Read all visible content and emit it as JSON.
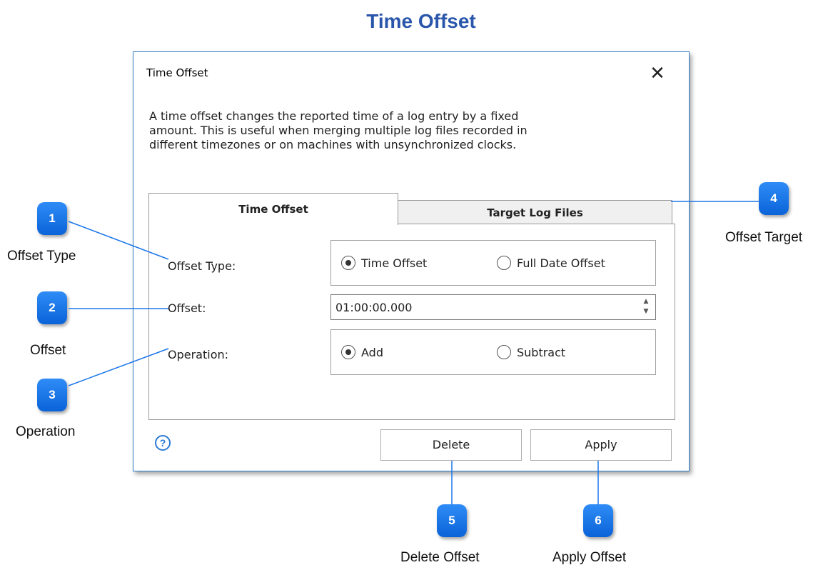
{
  "page": {
    "title": "Time Offset"
  },
  "dialog": {
    "title": "Time Offset",
    "close_glyph": "✕",
    "description": "A time offset changes the reported time of a log entry by a fixed\namount.  This is useful when merging multiple log files recorded in\ndifferent timezones or on machines with unsynchronized clocks.",
    "tabs": [
      {
        "label": "Time Offset",
        "active": true
      },
      {
        "label": "Target Log Files",
        "active": false
      }
    ],
    "offset_type": {
      "label": "Offset Type:",
      "options": [
        "Time Offset",
        "Full Date Offset"
      ],
      "selected": "Time Offset"
    },
    "offset": {
      "label": "Offset:",
      "value": "01:00:00.000"
    },
    "operation": {
      "label": "Operation:",
      "options": [
        "Add",
        "Subtract"
      ],
      "selected": "Add"
    },
    "help_glyph": "?",
    "buttons": {
      "delete": "Delete",
      "apply": "Apply"
    }
  },
  "callouts": [
    {
      "number": "1",
      "label": "Offset Type"
    },
    {
      "number": "2",
      "label": "Offset"
    },
    {
      "number": "3",
      "label": "Operation"
    },
    {
      "number": "4",
      "label": "Offset Target"
    },
    {
      "number": "5",
      "label": "Delete Offset"
    },
    {
      "number": "6",
      "label": "Apply Offset"
    }
  ],
  "colors": {
    "title": "#2a57ab",
    "badge": "#1a76ea",
    "callout_line": "#1a76ea",
    "dialog_border": "#2d7bc7"
  }
}
